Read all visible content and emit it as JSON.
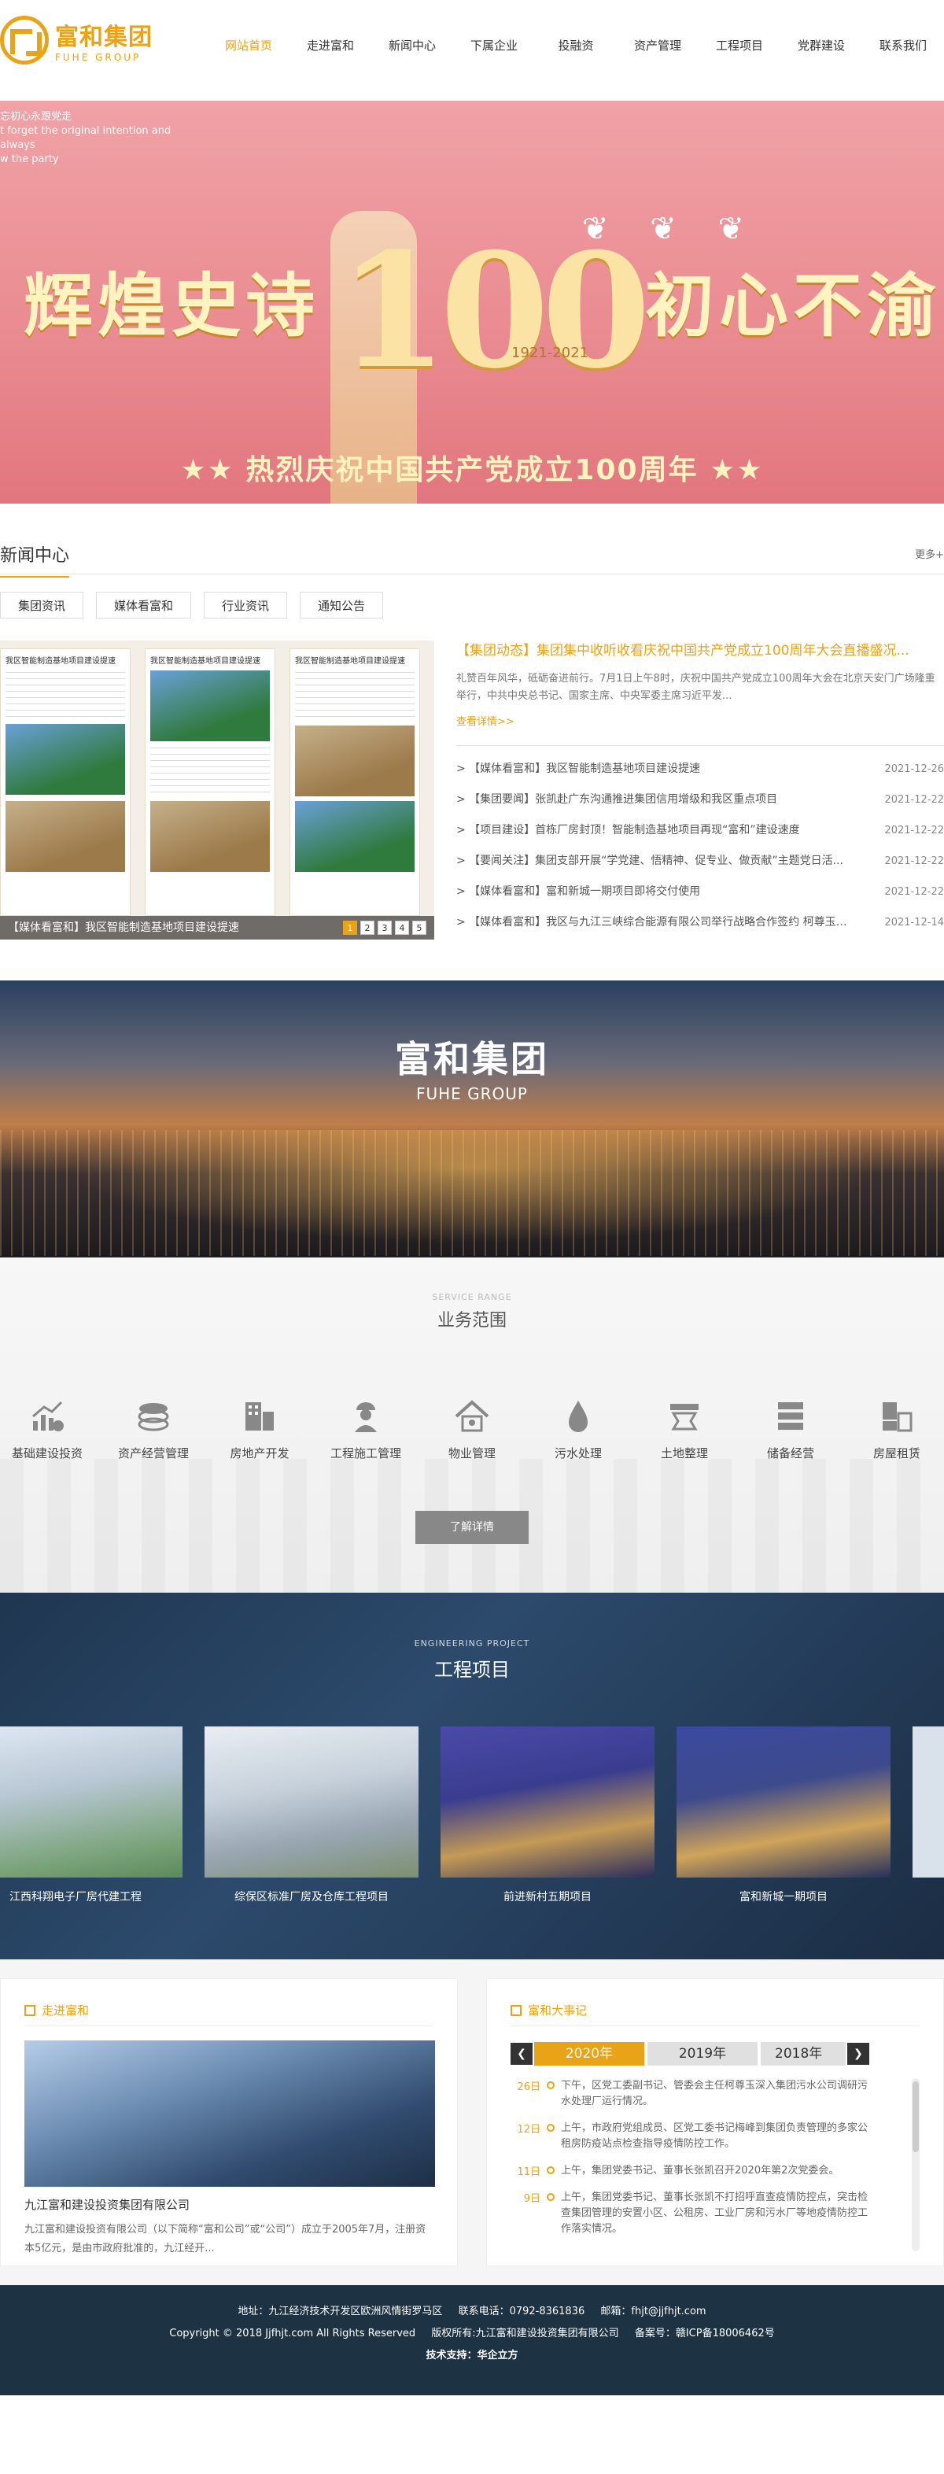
{
  "brand": {
    "name_cn": "富和集团",
    "name_en": "FUHE GROUP",
    "accent": "#e8a317"
  },
  "nav": [
    {
      "label": "网站首页",
      "active": true
    },
    {
      "label": "走进富和"
    },
    {
      "label": "新闻中心"
    },
    {
      "label": "下属企业"
    },
    {
      "label": "投融资"
    },
    {
      "label": "资产管理"
    },
    {
      "label": "工程项目"
    },
    {
      "label": "党群建设"
    },
    {
      "label": "联系我们"
    }
  ],
  "banner": {
    "top_line1": "忘初心永跟党走",
    "top_line2": "t forget the original intention and always",
    "top_line3": "w the party",
    "title_left": "辉煌史诗",
    "title_number": "100",
    "title_years": "1921-2021",
    "title_right": "初心不渝",
    "subtitle": "★★ 热烈庆祝中国共产党成立100周年 ★★"
  },
  "news": {
    "title": "新闻中心",
    "more": "更多+",
    "tabs": [
      "集团资讯",
      "媒体看富和",
      "行业资讯",
      "通知公告"
    ],
    "slide_col_title": "我区智能制造基地项目建设提速",
    "slide_caption": "【媒体看富和】我区智能制造基地项目建设提速",
    "pager": [
      "1",
      "2",
      "3",
      "4",
      "5"
    ],
    "headline": "【集团动态】集团集中收听收看庆祝中国共产党成立100周年大会直播盛况...",
    "headline_desc": "礼赞百年风华，砥砺奋进前行。7月1日上午8时，庆祝中国共产党成立100周年大会在北京天安门广场隆重举行，中共中央总书记、国家主席、中央军委主席习近平发...",
    "detail_link": "查看详情>>",
    "items": [
      {
        "title": ">  【媒体看富和】我区智能制造基地项目建设提速",
        "date": "2021-12-26"
      },
      {
        "title": ">  【集团要闻】张凯赴广东沟通推进集团信用增级和我区重点项目",
        "date": "2021-12-22"
      },
      {
        "title": ">  【项目建设】首栋厂房封顶！智能制造基地项目再现“富和”建设速度",
        "date": "2021-12-22"
      },
      {
        "title": ">  【要闻关注】集团支部开展“学党建、悟精神、促专业、做贡献”主题党日活...",
        "date": "2021-12-22"
      },
      {
        "title": ">  【媒体看富和】富和新城一期项目即将交付使用",
        "date": "2021-12-22"
      },
      {
        "title": ">  【媒体看富和】我区与九江三峡综合能源有限公司举行战略合作签约 柯尊玉出...",
        "date": "2021-12-14"
      }
    ]
  },
  "group": {
    "name_cn": "富和集团",
    "name_en": "FUHE GROUP"
  },
  "service": {
    "subtitle": "SERVICE RANGE",
    "title": "业务范围",
    "items": [
      {
        "label": "基础建设投资",
        "icon": "chart-icon"
      },
      {
        "label": "资产经营管理",
        "icon": "coins-icon"
      },
      {
        "label": "房地产开发",
        "icon": "building-icon"
      },
      {
        "label": "工程施工管理",
        "icon": "worker-icon"
      },
      {
        "label": "物业管理",
        "icon": "house-icon"
      },
      {
        "label": "污水处理",
        "icon": "water-drop-icon"
      },
      {
        "label": "土地整理",
        "icon": "land-icon"
      },
      {
        "label": "储备经营",
        "icon": "server-icon"
      },
      {
        "label": "房屋租赁",
        "icon": "rental-icon"
      }
    ],
    "button": "了解详情"
  },
  "project": {
    "subtitle": "ENGINEERING PROJECT",
    "title": "工程项目",
    "items": [
      {
        "name": "江西科翔电子厂房代建工程"
      },
      {
        "name": "综保区标准厂房及仓库工程项目"
      },
      {
        "name": "前进新村五期项目"
      },
      {
        "name": "富和新城一期项目"
      }
    ]
  },
  "about": {
    "title": "走进富和",
    "company": "九江富和建设投资集团有限公司",
    "desc": "九江富和建设投资有限公司（以下简称“富和公司”或“公司”）成立于2005年7月，注册资本5亿元，是由市政府批准的，九江经开..."
  },
  "events": {
    "title": "富和大事记",
    "years": [
      "2020年",
      "2019年",
      "2018年"
    ],
    "items": [
      {
        "date": "26日",
        "text": "下午，区党工委副书记、管委会主任柯尊玉深入集团污水公司调研污水处理厂运行情况。"
      },
      {
        "date": "12日",
        "text": "上午，市政府党组成员、区党工委书记梅峰到集团负责管理的多家公租房防疫站点检查指导疫情防控工作。"
      },
      {
        "date": "11日",
        "text": "上午，集团党委书记、董事长张凯召开2020年第2次党委会。"
      },
      {
        "date": "9日",
        "text": "上午，集团党委书记、董事长张凯不打招呼直查疫情防控点，突击检查集团管理的安置小区、公租房、工业厂房和污水厂等地疫情防控工作落实情况。"
      }
    ]
  },
  "footer": {
    "address": "地址：九江经济技术开发区欧洲风情街罗马区",
    "phone": "联系电话：0792-8361836",
    "email": "邮箱：fhjt@jjfhjt.com",
    "copyright": "Copyright © 2018 Jjfhjt.com All Rights Reserved",
    "rights": "版权所有:九江富和建设投资集团有限公司",
    "icp": "备案号：赣ICP备18006462号",
    "support_label": "技术支持：",
    "support": "华企立方"
  }
}
